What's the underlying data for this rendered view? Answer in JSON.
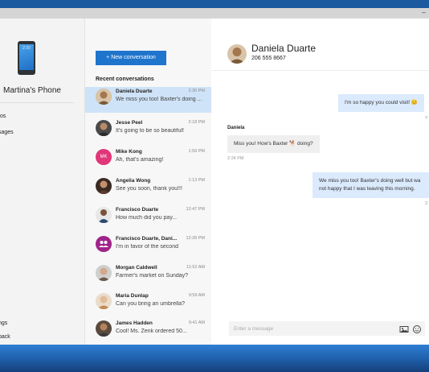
{
  "window": {
    "minimize_glyph": "–"
  },
  "left_pane": {
    "phone_screen_text": "2:30",
    "phone_name": "Martina's Phone",
    "nav_items": [
      "tos",
      "sages",
      "ngs",
      "back"
    ]
  },
  "list": {
    "new_conversation_label": "+ New conversation",
    "recent_label": "Recent conversations",
    "conversations": [
      {
        "name": "Daniela Duarte",
        "time": "2:30 PM",
        "preview": "We miss you too! Baxter's doing ...",
        "active": true
      },
      {
        "name": "Jesse Peel",
        "time": "2:18 PM",
        "preview": "It's going to be so beautiful!",
        "active": false
      },
      {
        "name": "Mike Kong",
        "time": "1:59 PM",
        "preview": "Ah, that's amazing!",
        "initials": "MK",
        "active": false
      },
      {
        "name": "Angelia Wong",
        "time": "1:13 PM",
        "preview": "See you soon, thank you!!!",
        "active": false
      },
      {
        "name": "Francisco Duarte",
        "time": "12:47 PM",
        "preview": "How much did you pay...",
        "active": false
      },
      {
        "name": "Francisco Duarte, Dani...",
        "time": "12:28 PM",
        "preview": "I'm in favor of the second",
        "active": false
      },
      {
        "name": "Morgan Caldwell",
        "time": "11:52 AM",
        "preview": "Farmer's market on Sunday?",
        "active": false
      },
      {
        "name": "Maria Dunlap",
        "time": "9:59 AM",
        "preview": "Can you bring an umbrella?",
        "active": false
      },
      {
        "name": "James Hadden",
        "time": "9:41 AM",
        "preview": "Cool! Ms. Zenk ordered 50...",
        "active": false
      }
    ]
  },
  "chat": {
    "contact_name": "Daniela Duarte",
    "contact_phone": "206 555 8667",
    "messages": {
      "out_1": "I'm so happy you could visit! 😊",
      "out_1_time": "Y",
      "sender_label": "Daniela",
      "in_1": "Miss you! How's Baxter 🐕 doing?",
      "in_1_time": "2:24 PM",
      "out_2_line1": "We miss you too! Baxter's doing well but wa",
      "out_2_line2": "not happy that I was leaving this morning.",
      "out_2_time": "2:"
    },
    "input_placeholder": "Enter a message"
  },
  "colors": {
    "accent": "#1f74cc",
    "active_row": "#cfe3f8",
    "outgoing_bubble": "#dbeafc",
    "incoming_bubble": "#efefef"
  },
  "icons": [
    "phone-icon",
    "image-icon",
    "emoji-icon",
    "plus-icon"
  ]
}
